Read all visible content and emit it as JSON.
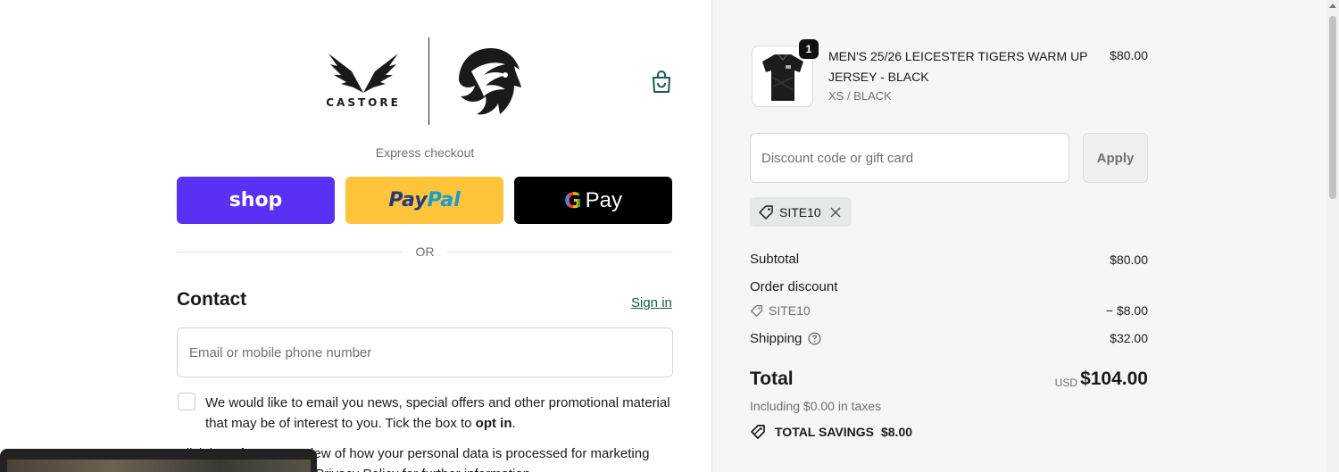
{
  "brand": {
    "name": "CASTORE"
  },
  "express": {
    "label": "Express checkout",
    "shop_label": "shop",
    "paypal_pay": "Pay",
    "paypal_pal": "Pal",
    "gpay_g": "G",
    "gpay_label": "Pay",
    "or_label": "OR"
  },
  "contact": {
    "heading": "Contact",
    "sign_in": "Sign in",
    "email_placeholder": "Email or mobile phone number",
    "optin_text": "We would like to email you news, special offers and other promotional material that may be of interest to you. Tick the box to",
    "optin_bold": "opt in",
    "optin_end": ".",
    "privacy_partial": "Click here for an overview of how your personal data is processed for marketing purposes and read our Privacy Policy for further information."
  },
  "order": {
    "item": {
      "quantity": "1",
      "name": "MEN'S 25/26 LEICESTER TIGERS WARM UP JERSEY - BLACK",
      "variant": "XS / BLACK",
      "price": "$80.00"
    },
    "discount_placeholder": "Discount code or gift card",
    "apply_label": "Apply",
    "applied_code": "SITE10",
    "subtotal_label": "Subtotal",
    "subtotal_value": "$80.00",
    "order_discount_label": "Order discount",
    "discount_code": "SITE10",
    "discount_value": "− $8.00",
    "shipping_label": "Shipping",
    "shipping_value": "$32.00",
    "total_label": "Total",
    "currency": "USD",
    "total_value": "$104.00",
    "taxes_text": "Including $0.00 in taxes",
    "savings_label": "TOTAL SAVINGS",
    "savings_value": "$8.00"
  },
  "colors": {
    "shop_purple": "#5a31f4",
    "paypal_yellow": "#ffc439",
    "link_green": "#1a5b4c",
    "sidebar_bg": "#f4f7f6"
  }
}
